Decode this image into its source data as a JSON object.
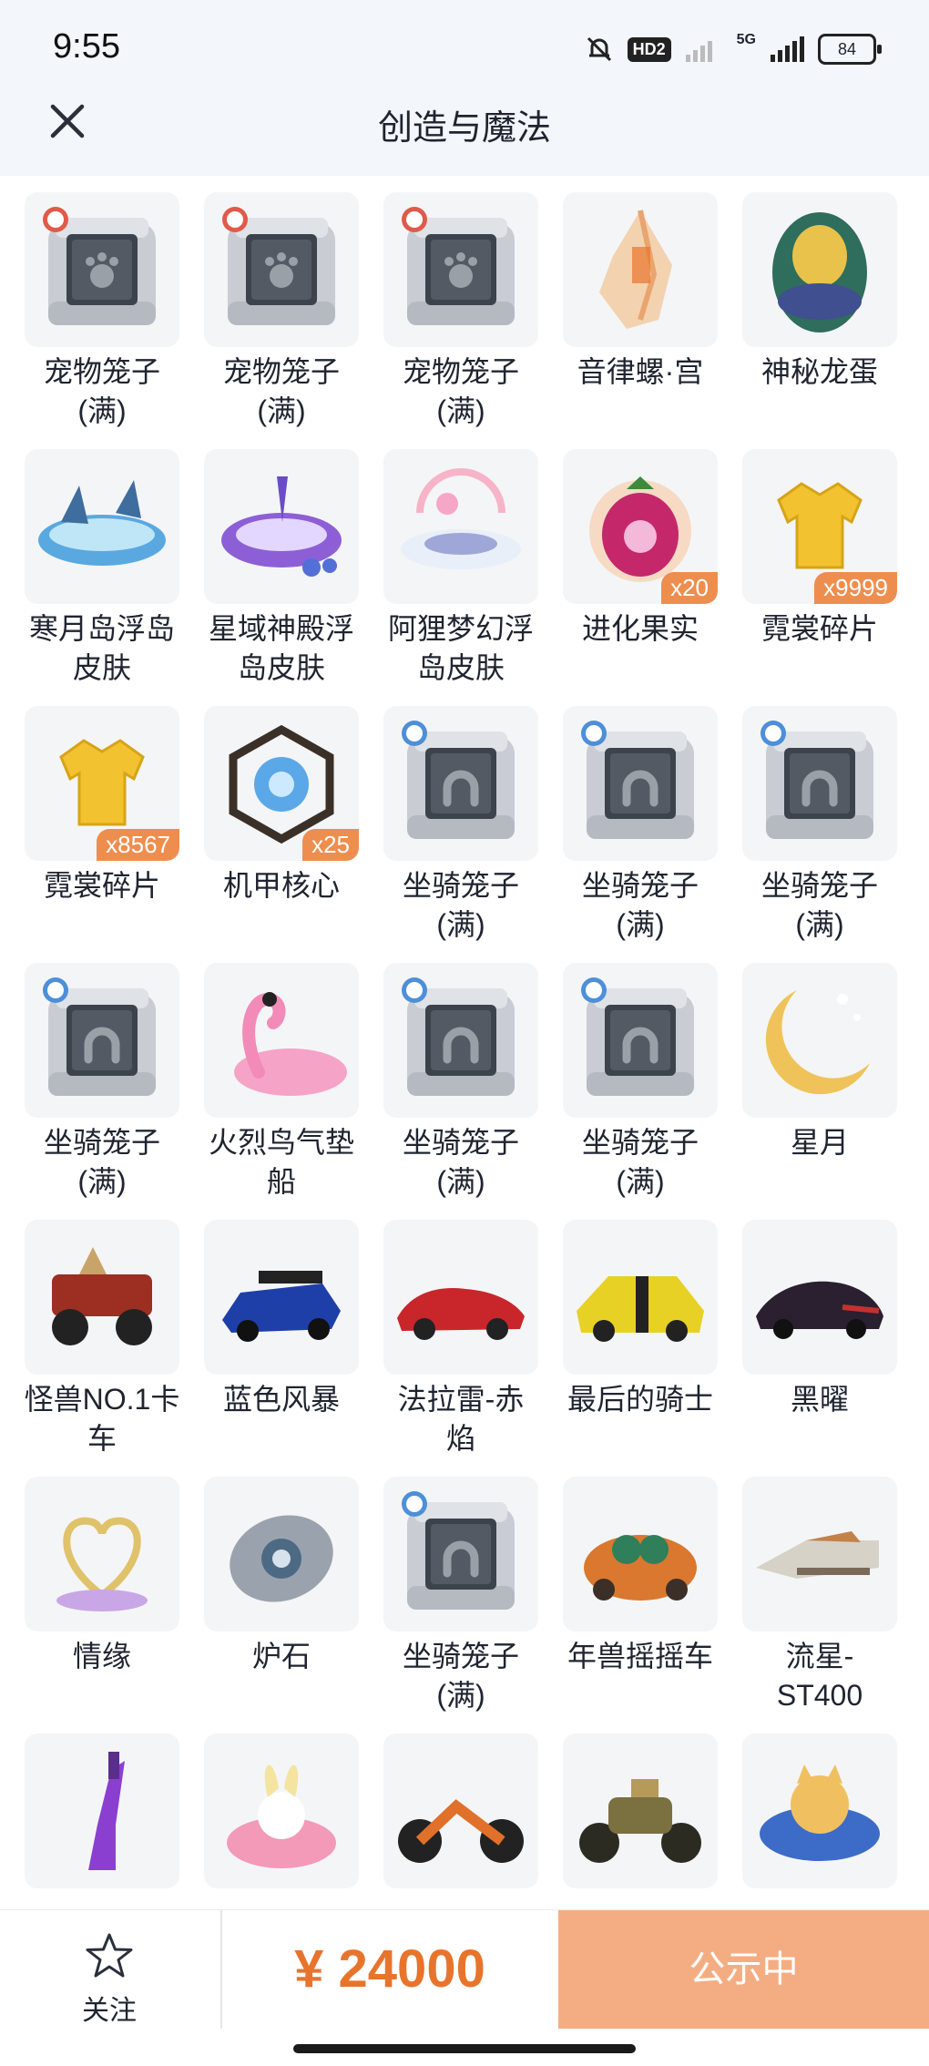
{
  "status": {
    "time": "9:55",
    "hd": "HD2",
    "network": "5G",
    "battery": "84",
    "icons": [
      "mute-bell-icon",
      "signal-icon",
      "battery-icon"
    ]
  },
  "header": {
    "title": "创造与魔法",
    "close_icon": "close-icon"
  },
  "items": [
    {
      "name": "宠物笼子",
      "sub": "(满)",
      "icon": "pet-cage"
    },
    {
      "name": "宠物笼子",
      "sub": "(满)",
      "icon": "pet-cage"
    },
    {
      "name": "宠物笼子",
      "sub": "(满)",
      "icon": "pet-cage"
    },
    {
      "name": "音律螺·宫",
      "sub": "",
      "icon": "conch-shell"
    },
    {
      "name": "神秘龙蛋",
      "sub": "",
      "icon": "dragon-egg"
    },
    {
      "name": "寒月岛浮岛",
      "sub": "皮肤",
      "icon": "floating-island-ice"
    },
    {
      "name": "星域神殿浮",
      "sub": "岛皮肤",
      "icon": "floating-island-star"
    },
    {
      "name": "阿狸梦幻浮",
      "sub": "岛皮肤",
      "icon": "floating-island-dream"
    },
    {
      "name": "进化果实",
      "sub": "",
      "icon": "evolution-fruit",
      "qty": "x20"
    },
    {
      "name": "霓裳碎片",
      "sub": "",
      "icon": "shirt-fragment",
      "qty": "x9999"
    },
    {
      "name": "霓裳碎片",
      "sub": "",
      "icon": "shirt-fragment",
      "qty": "x8567"
    },
    {
      "name": "机甲核心",
      "sub": "",
      "icon": "mech-core",
      "qty": "x25"
    },
    {
      "name": "坐骑笼子",
      "sub": "(满)",
      "icon": "mount-cage"
    },
    {
      "name": "坐骑笼子",
      "sub": "(满)",
      "icon": "mount-cage"
    },
    {
      "name": "坐骑笼子",
      "sub": "(满)",
      "icon": "mount-cage"
    },
    {
      "name": "坐骑笼子",
      "sub": "(满)",
      "icon": "mount-cage"
    },
    {
      "name": "火烈鸟气垫",
      "sub": "船",
      "icon": "flamingo-float"
    },
    {
      "name": "坐骑笼子",
      "sub": "(满)",
      "icon": "mount-cage"
    },
    {
      "name": "坐骑笼子",
      "sub": "(满)",
      "icon": "mount-cage"
    },
    {
      "name": "星月",
      "sub": "",
      "icon": "crescent-moon"
    },
    {
      "name": "怪兽NO.1卡",
      "sub": "车",
      "icon": "monster-truck"
    },
    {
      "name": "蓝色风暴",
      "sub": "",
      "icon": "blue-race-car"
    },
    {
      "name": "法拉雷-赤",
      "sub": "焰",
      "icon": "red-sports-car"
    },
    {
      "name": "最后的骑士",
      "sub": "",
      "icon": "yellow-muscle-car"
    },
    {
      "name": "黑曜",
      "sub": "",
      "icon": "black-classic-car"
    },
    {
      "name": "情缘",
      "sub": "",
      "icon": "heart-ornament"
    },
    {
      "name": "炉石",
      "sub": "",
      "icon": "hearthstone"
    },
    {
      "name": "坐骑笼子",
      "sub": "(满)",
      "icon": "mount-cage"
    },
    {
      "name": "年兽摇摇车",
      "sub": "",
      "icon": "nian-beast-car"
    },
    {
      "name": "流星-",
      "sub": "ST400",
      "icon": "meteor-hovercar"
    },
    {
      "name": "",
      "sub": "",
      "icon": "purple-guitar"
    },
    {
      "name": "",
      "sub": "",
      "icon": "bunny-lotus"
    },
    {
      "name": "",
      "sub": "",
      "icon": "orange-motorcycle"
    },
    {
      "name": "",
      "sub": "",
      "icon": "army-motorcycle"
    },
    {
      "name": "",
      "sub": "",
      "icon": "cat-kart"
    }
  ],
  "bottom": {
    "follow_label": "关注",
    "price": "¥ 24000",
    "status_button": "公示中"
  },
  "colors": {
    "accent": "#e8742c",
    "button": "#f4ad82",
    "badge": "#ee8e4e",
    "header_bg": "#f3f6fa"
  }
}
